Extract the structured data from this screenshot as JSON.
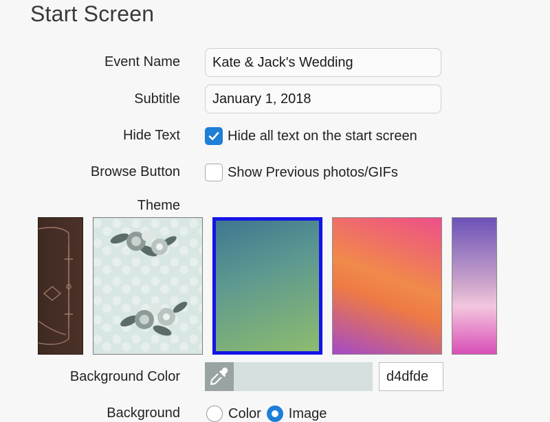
{
  "page": {
    "title": "Start Screen"
  },
  "fields": {
    "event_name": {
      "label": "Event Name",
      "value": "Kate & Jack's Wedding"
    },
    "subtitle": {
      "label": "Subtitle",
      "value": "January 1, 2018"
    },
    "hide_text": {
      "label": "Hide Text",
      "checked": true,
      "option_text": "Hide all text on the start screen"
    },
    "browse_button": {
      "label": "Browse Button",
      "checked": false,
      "option_text": "Show Previous photos/GIFs"
    }
  },
  "theme": {
    "label": "Theme",
    "selected": "teal-gradient",
    "tiles": [
      "dark-ornate",
      "floral-roses",
      "teal-gradient",
      "sunset-gradient",
      "purple-pink-gradient"
    ]
  },
  "background_color": {
    "label": "Background Color",
    "hex": "d4dfde",
    "swatch_color": "#d4dfde",
    "eyedropper_icon": "eyedropper-icon"
  },
  "background": {
    "label": "Background",
    "options": [
      {
        "label": "Color",
        "selected": false
      },
      {
        "label": "Image",
        "selected": true
      }
    ]
  },
  "colors": {
    "accent": "#1d7fd6",
    "selection_border": "#1414e6"
  }
}
